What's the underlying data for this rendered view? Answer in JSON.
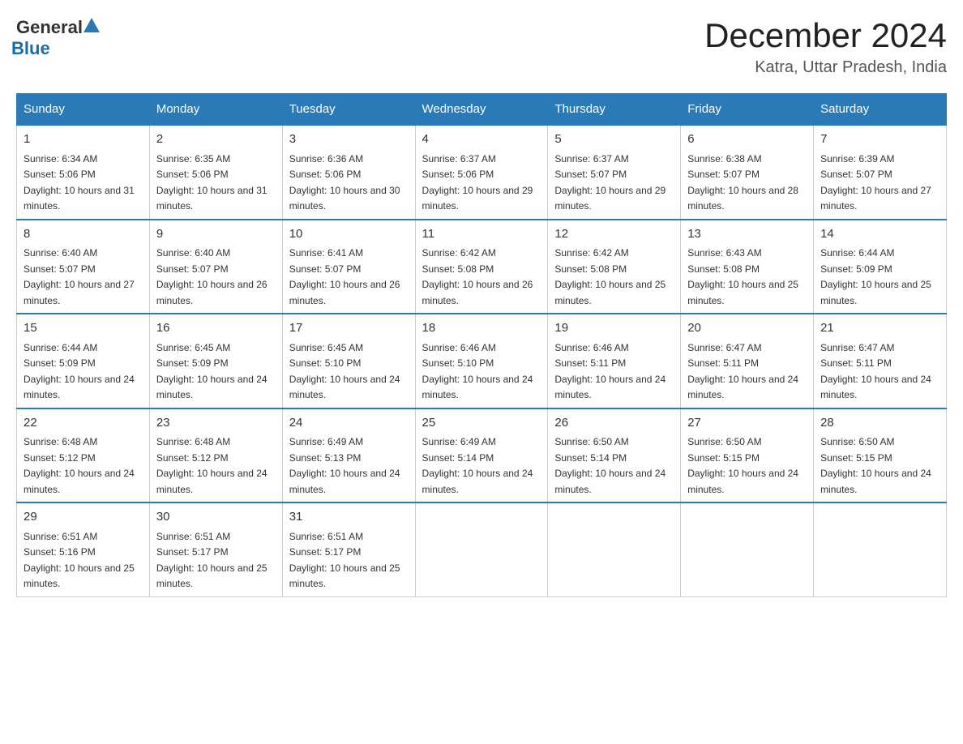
{
  "header": {
    "logo_general": "General",
    "logo_blue": "Blue",
    "title": "December 2024",
    "subtitle": "Katra, Uttar Pradesh, India"
  },
  "days_of_week": [
    "Sunday",
    "Monday",
    "Tuesday",
    "Wednesday",
    "Thursday",
    "Friday",
    "Saturday"
  ],
  "weeks": [
    [
      {
        "day": "1",
        "sunrise": "6:34 AM",
        "sunset": "5:06 PM",
        "daylight": "10 hours and 31 minutes."
      },
      {
        "day": "2",
        "sunrise": "6:35 AM",
        "sunset": "5:06 PM",
        "daylight": "10 hours and 31 minutes."
      },
      {
        "day": "3",
        "sunrise": "6:36 AM",
        "sunset": "5:06 PM",
        "daylight": "10 hours and 30 minutes."
      },
      {
        "day": "4",
        "sunrise": "6:37 AM",
        "sunset": "5:06 PM",
        "daylight": "10 hours and 29 minutes."
      },
      {
        "day": "5",
        "sunrise": "6:37 AM",
        "sunset": "5:07 PM",
        "daylight": "10 hours and 29 minutes."
      },
      {
        "day": "6",
        "sunrise": "6:38 AM",
        "sunset": "5:07 PM",
        "daylight": "10 hours and 28 minutes."
      },
      {
        "day": "7",
        "sunrise": "6:39 AM",
        "sunset": "5:07 PM",
        "daylight": "10 hours and 27 minutes."
      }
    ],
    [
      {
        "day": "8",
        "sunrise": "6:40 AM",
        "sunset": "5:07 PM",
        "daylight": "10 hours and 27 minutes."
      },
      {
        "day": "9",
        "sunrise": "6:40 AM",
        "sunset": "5:07 PM",
        "daylight": "10 hours and 26 minutes."
      },
      {
        "day": "10",
        "sunrise": "6:41 AM",
        "sunset": "5:07 PM",
        "daylight": "10 hours and 26 minutes."
      },
      {
        "day": "11",
        "sunrise": "6:42 AM",
        "sunset": "5:08 PM",
        "daylight": "10 hours and 26 minutes."
      },
      {
        "day": "12",
        "sunrise": "6:42 AM",
        "sunset": "5:08 PM",
        "daylight": "10 hours and 25 minutes."
      },
      {
        "day": "13",
        "sunrise": "6:43 AM",
        "sunset": "5:08 PM",
        "daylight": "10 hours and 25 minutes."
      },
      {
        "day": "14",
        "sunrise": "6:44 AM",
        "sunset": "5:09 PM",
        "daylight": "10 hours and 25 minutes."
      }
    ],
    [
      {
        "day": "15",
        "sunrise": "6:44 AM",
        "sunset": "5:09 PM",
        "daylight": "10 hours and 24 minutes."
      },
      {
        "day": "16",
        "sunrise": "6:45 AM",
        "sunset": "5:09 PM",
        "daylight": "10 hours and 24 minutes."
      },
      {
        "day": "17",
        "sunrise": "6:45 AM",
        "sunset": "5:10 PM",
        "daylight": "10 hours and 24 minutes."
      },
      {
        "day": "18",
        "sunrise": "6:46 AM",
        "sunset": "5:10 PM",
        "daylight": "10 hours and 24 minutes."
      },
      {
        "day": "19",
        "sunrise": "6:46 AM",
        "sunset": "5:11 PM",
        "daylight": "10 hours and 24 minutes."
      },
      {
        "day": "20",
        "sunrise": "6:47 AM",
        "sunset": "5:11 PM",
        "daylight": "10 hours and 24 minutes."
      },
      {
        "day": "21",
        "sunrise": "6:47 AM",
        "sunset": "5:11 PM",
        "daylight": "10 hours and 24 minutes."
      }
    ],
    [
      {
        "day": "22",
        "sunrise": "6:48 AM",
        "sunset": "5:12 PM",
        "daylight": "10 hours and 24 minutes."
      },
      {
        "day": "23",
        "sunrise": "6:48 AM",
        "sunset": "5:12 PM",
        "daylight": "10 hours and 24 minutes."
      },
      {
        "day": "24",
        "sunrise": "6:49 AM",
        "sunset": "5:13 PM",
        "daylight": "10 hours and 24 minutes."
      },
      {
        "day": "25",
        "sunrise": "6:49 AM",
        "sunset": "5:14 PM",
        "daylight": "10 hours and 24 minutes."
      },
      {
        "day": "26",
        "sunrise": "6:50 AM",
        "sunset": "5:14 PM",
        "daylight": "10 hours and 24 minutes."
      },
      {
        "day": "27",
        "sunrise": "6:50 AM",
        "sunset": "5:15 PM",
        "daylight": "10 hours and 24 minutes."
      },
      {
        "day": "28",
        "sunrise": "6:50 AM",
        "sunset": "5:15 PM",
        "daylight": "10 hours and 24 minutes."
      }
    ],
    [
      {
        "day": "29",
        "sunrise": "6:51 AM",
        "sunset": "5:16 PM",
        "daylight": "10 hours and 25 minutes."
      },
      {
        "day": "30",
        "sunrise": "6:51 AM",
        "sunset": "5:17 PM",
        "daylight": "10 hours and 25 minutes."
      },
      {
        "day": "31",
        "sunrise": "6:51 AM",
        "sunset": "5:17 PM",
        "daylight": "10 hours and 25 minutes."
      },
      null,
      null,
      null,
      null
    ]
  ],
  "labels": {
    "sunrise": "Sunrise:",
    "sunset": "Sunset:",
    "daylight": "Daylight:"
  }
}
